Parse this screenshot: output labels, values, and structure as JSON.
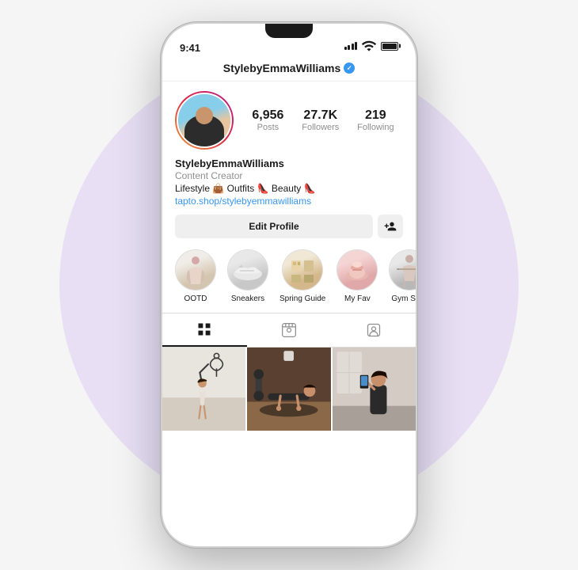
{
  "background": {
    "circle_color": "#e8dff5"
  },
  "phone": {
    "status_bar": {
      "time": "9:41",
      "signal_label": "signal",
      "wifi_label": "wifi",
      "battery_label": "battery"
    },
    "header": {
      "username": "StylebyEmmaWilliams",
      "verified": true,
      "verified_label": "verified"
    },
    "profile": {
      "avatar_alt": "Profile photo of Emma Williams",
      "stats": [
        {
          "number": "6,956",
          "label": "Posts"
        },
        {
          "number": "27.7K",
          "label": "Followers"
        },
        {
          "number": "219",
          "label": "Following"
        }
      ],
      "bio": {
        "name": "StylebyEmmaWilliams",
        "title": "Content Creator",
        "description": "Lifestyle 👜 Outfits 👠 Beauty 👠",
        "link": "tapto.shop/stylebyemmawilliams"
      },
      "buttons": {
        "edit_profile": "Edit Profile",
        "add_friend": "add-person"
      },
      "highlights": [
        {
          "label": "OOTD",
          "emoji": "🧍"
        },
        {
          "label": "Sneakers",
          "emoji": "👟"
        },
        {
          "label": "Spring Guide",
          "emoji": "🛍️"
        },
        {
          "label": "My Fav",
          "emoji": "💋"
        },
        {
          "label": "Gym Style",
          "emoji": "💪"
        }
      ]
    },
    "tabs": [
      {
        "id": "grid",
        "label": "grid",
        "active": true
      },
      {
        "id": "reels",
        "label": "reels",
        "active": false
      },
      {
        "id": "tagged",
        "label": "tagged",
        "active": false
      }
    ],
    "grid": {
      "photos": [
        {
          "id": "photo-1",
          "type": "illustration",
          "bg": "#f8f5f0"
        },
        {
          "id": "photo-2",
          "type": "fitness",
          "bg": "#7a6050"
        },
        {
          "id": "photo-3",
          "type": "lifestyle",
          "bg": "#c0b0a8"
        }
      ]
    }
  }
}
